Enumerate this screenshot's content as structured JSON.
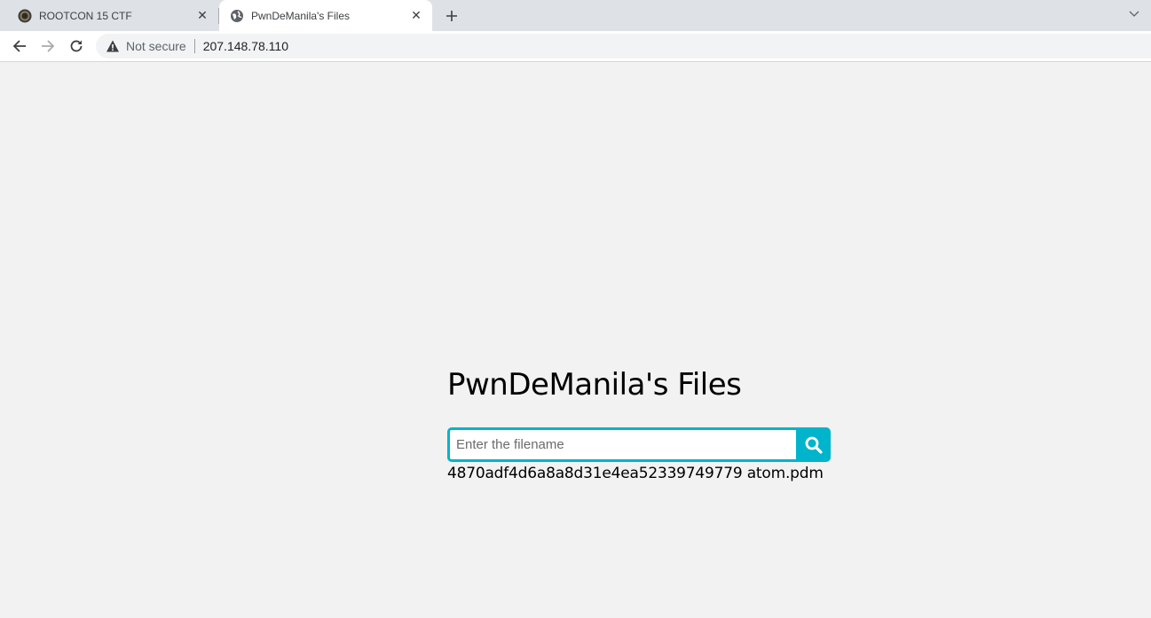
{
  "browser": {
    "tabs": [
      {
        "title": "ROOTCON 15 CTF",
        "active": false,
        "favicon": "rootcon-logo-icon"
      },
      {
        "title": "PwnDeManila's Files",
        "active": true,
        "favicon": "globe-icon"
      }
    ],
    "address_bar": {
      "security_label": "Not secure",
      "url": "207.148.78.110"
    }
  },
  "page": {
    "title": "PwnDeManila's Files",
    "search": {
      "placeholder": "Enter the filename",
      "value": ""
    },
    "result": "4870adf4d6a8a8d31e4ea52339749779 atom.pdm"
  },
  "colors": {
    "accent": "#00b4cc",
    "page_background": "#f2f2f2"
  }
}
